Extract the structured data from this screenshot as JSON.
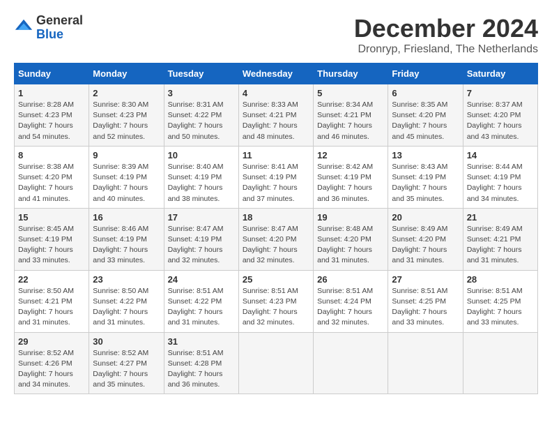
{
  "logo": {
    "line1": "General",
    "line2": "Blue"
  },
  "title": "December 2024",
  "location": "Dronryp, Friesland, The Netherlands",
  "days_header": [
    "Sunday",
    "Monday",
    "Tuesday",
    "Wednesday",
    "Thursday",
    "Friday",
    "Saturday"
  ],
  "weeks": [
    [
      {
        "day": "1",
        "sunrise": "Sunrise: 8:28 AM",
        "sunset": "Sunset: 4:23 PM",
        "daylight": "Daylight: 7 hours and 54 minutes."
      },
      {
        "day": "2",
        "sunrise": "Sunrise: 8:30 AM",
        "sunset": "Sunset: 4:23 PM",
        "daylight": "Daylight: 7 hours and 52 minutes."
      },
      {
        "day": "3",
        "sunrise": "Sunrise: 8:31 AM",
        "sunset": "Sunset: 4:22 PM",
        "daylight": "Daylight: 7 hours and 50 minutes."
      },
      {
        "day": "4",
        "sunrise": "Sunrise: 8:33 AM",
        "sunset": "Sunset: 4:21 PM",
        "daylight": "Daylight: 7 hours and 48 minutes."
      },
      {
        "day": "5",
        "sunrise": "Sunrise: 8:34 AM",
        "sunset": "Sunset: 4:21 PM",
        "daylight": "Daylight: 7 hours and 46 minutes."
      },
      {
        "day": "6",
        "sunrise": "Sunrise: 8:35 AM",
        "sunset": "Sunset: 4:20 PM",
        "daylight": "Daylight: 7 hours and 45 minutes."
      },
      {
        "day": "7",
        "sunrise": "Sunrise: 8:37 AM",
        "sunset": "Sunset: 4:20 PM",
        "daylight": "Daylight: 7 hours and 43 minutes."
      }
    ],
    [
      {
        "day": "8",
        "sunrise": "Sunrise: 8:38 AM",
        "sunset": "Sunset: 4:20 PM",
        "daylight": "Daylight: 7 hours and 41 minutes."
      },
      {
        "day": "9",
        "sunrise": "Sunrise: 8:39 AM",
        "sunset": "Sunset: 4:19 PM",
        "daylight": "Daylight: 7 hours and 40 minutes."
      },
      {
        "day": "10",
        "sunrise": "Sunrise: 8:40 AM",
        "sunset": "Sunset: 4:19 PM",
        "daylight": "Daylight: 7 hours and 38 minutes."
      },
      {
        "day": "11",
        "sunrise": "Sunrise: 8:41 AM",
        "sunset": "Sunset: 4:19 PM",
        "daylight": "Daylight: 7 hours and 37 minutes."
      },
      {
        "day": "12",
        "sunrise": "Sunrise: 8:42 AM",
        "sunset": "Sunset: 4:19 PM",
        "daylight": "Daylight: 7 hours and 36 minutes."
      },
      {
        "day": "13",
        "sunrise": "Sunrise: 8:43 AM",
        "sunset": "Sunset: 4:19 PM",
        "daylight": "Daylight: 7 hours and 35 minutes."
      },
      {
        "day": "14",
        "sunrise": "Sunrise: 8:44 AM",
        "sunset": "Sunset: 4:19 PM",
        "daylight": "Daylight: 7 hours and 34 minutes."
      }
    ],
    [
      {
        "day": "15",
        "sunrise": "Sunrise: 8:45 AM",
        "sunset": "Sunset: 4:19 PM",
        "daylight": "Daylight: 7 hours and 33 minutes."
      },
      {
        "day": "16",
        "sunrise": "Sunrise: 8:46 AM",
        "sunset": "Sunset: 4:19 PM",
        "daylight": "Daylight: 7 hours and 33 minutes."
      },
      {
        "day": "17",
        "sunrise": "Sunrise: 8:47 AM",
        "sunset": "Sunset: 4:19 PM",
        "daylight": "Daylight: 7 hours and 32 minutes."
      },
      {
        "day": "18",
        "sunrise": "Sunrise: 8:47 AM",
        "sunset": "Sunset: 4:20 PM",
        "daylight": "Daylight: 7 hours and 32 minutes."
      },
      {
        "day": "19",
        "sunrise": "Sunrise: 8:48 AM",
        "sunset": "Sunset: 4:20 PM",
        "daylight": "Daylight: 7 hours and 31 minutes."
      },
      {
        "day": "20",
        "sunrise": "Sunrise: 8:49 AM",
        "sunset": "Sunset: 4:20 PM",
        "daylight": "Daylight: 7 hours and 31 minutes."
      },
      {
        "day": "21",
        "sunrise": "Sunrise: 8:49 AM",
        "sunset": "Sunset: 4:21 PM",
        "daylight": "Daylight: 7 hours and 31 minutes."
      }
    ],
    [
      {
        "day": "22",
        "sunrise": "Sunrise: 8:50 AM",
        "sunset": "Sunset: 4:21 PM",
        "daylight": "Daylight: 7 hours and 31 minutes."
      },
      {
        "day": "23",
        "sunrise": "Sunrise: 8:50 AM",
        "sunset": "Sunset: 4:22 PM",
        "daylight": "Daylight: 7 hours and 31 minutes."
      },
      {
        "day": "24",
        "sunrise": "Sunrise: 8:51 AM",
        "sunset": "Sunset: 4:22 PM",
        "daylight": "Daylight: 7 hours and 31 minutes."
      },
      {
        "day": "25",
        "sunrise": "Sunrise: 8:51 AM",
        "sunset": "Sunset: 4:23 PM",
        "daylight": "Daylight: 7 hours and 32 minutes."
      },
      {
        "day": "26",
        "sunrise": "Sunrise: 8:51 AM",
        "sunset": "Sunset: 4:24 PM",
        "daylight": "Daylight: 7 hours and 32 minutes."
      },
      {
        "day": "27",
        "sunrise": "Sunrise: 8:51 AM",
        "sunset": "Sunset: 4:25 PM",
        "daylight": "Daylight: 7 hours and 33 minutes."
      },
      {
        "day": "28",
        "sunrise": "Sunrise: 8:51 AM",
        "sunset": "Sunset: 4:25 PM",
        "daylight": "Daylight: 7 hours and 33 minutes."
      }
    ],
    [
      {
        "day": "29",
        "sunrise": "Sunrise: 8:52 AM",
        "sunset": "Sunset: 4:26 PM",
        "daylight": "Daylight: 7 hours and 34 minutes."
      },
      {
        "day": "30",
        "sunrise": "Sunrise: 8:52 AM",
        "sunset": "Sunset: 4:27 PM",
        "daylight": "Daylight: 7 hours and 35 minutes."
      },
      {
        "day": "31",
        "sunrise": "Sunrise: 8:51 AM",
        "sunset": "Sunset: 4:28 PM",
        "daylight": "Daylight: 7 hours and 36 minutes."
      },
      null,
      null,
      null,
      null
    ]
  ]
}
